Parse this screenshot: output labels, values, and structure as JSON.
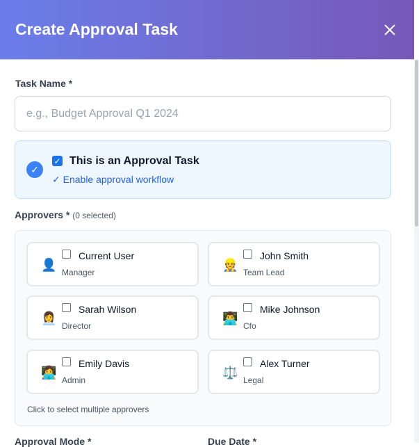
{
  "header": {
    "title": "Create Approval Task",
    "close_icon": "close-icon"
  },
  "task_name": {
    "label": "Task Name *",
    "placeholder": "e.g., Budget Approval Q1 2024",
    "value": ""
  },
  "approval_task": {
    "checked": true,
    "label": "This is an Approval Task",
    "subtitle": "✓ Enable approval workflow"
  },
  "approvers": {
    "label": "Approvers *",
    "count": "(0 selected)",
    "items": [
      {
        "name": "Current User",
        "role": "Manager",
        "icon": "👤",
        "icon_name": "user-silhouette-icon"
      },
      {
        "name": "John Smith",
        "role": "Team Lead",
        "icon": "👷",
        "icon_name": "worker-icon"
      },
      {
        "name": "Sarah Wilson",
        "role": "Director",
        "icon": "👩‍💼",
        "icon_name": "office-worker-icon"
      },
      {
        "name": "Mike Johnson",
        "role": "Cfo",
        "icon": "👨‍💻",
        "icon_name": "technologist-icon"
      },
      {
        "name": "Emily Davis",
        "role": "Admin",
        "icon": "👩‍💻",
        "icon_name": "technologist-icon"
      },
      {
        "name": "Alex Turner",
        "role": "Legal",
        "icon": "⚖️",
        "icon_name": "scales-icon"
      }
    ],
    "hint": "Click to select multiple approvers"
  },
  "approval_mode": {
    "label": "Approval Mode *"
  },
  "due_date": {
    "label": "Due Date *"
  },
  "colors": {
    "header_start": "#6a7ee9",
    "header_end": "#7758b8",
    "accent": "#2563eb",
    "approval_bg": "#eef6ff"
  }
}
